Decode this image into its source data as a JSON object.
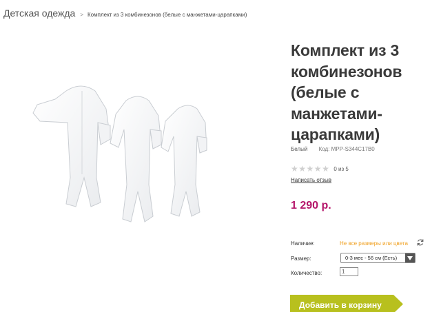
{
  "breadcrumb": {
    "root": "Детская одежда",
    "separator": ">",
    "current": "Комплект из 3 комбинезонов (белые с манжетами-царапками)"
  },
  "product": {
    "title_lines": [
      "Комплект из 3",
      "комбинезонов",
      "(белые с",
      "манжетами-",
      "царапками)"
    ],
    "color": "Белый",
    "code": "Код: MPP-S344C17B0",
    "rating_text": "0 из 5",
    "review_link": "Написать отзыв",
    "price": "1 290 р.",
    "price_color": "#b5166a",
    "image_icon": "baby-sleepsuits-image"
  },
  "details": {
    "availability_label": "Наличие:",
    "availability_value": "Не все размеры или цвета",
    "size_label": "Размер:",
    "size_value": "0-3 мес - 56 см (Есть)",
    "quantity_label": "Количество:",
    "quantity_value": "1"
  },
  "cart": {
    "label": "Добавить в корзину",
    "color": "#b8c01e"
  }
}
